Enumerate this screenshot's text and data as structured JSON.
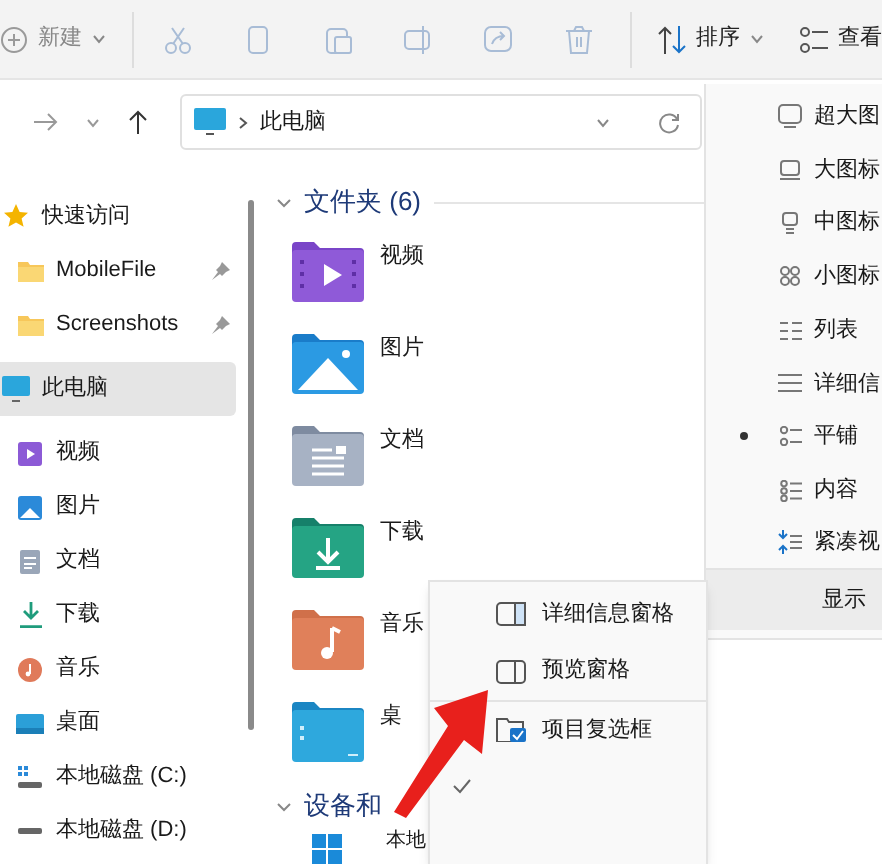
{
  "toolbar": {
    "items": [
      {
        "kind": "new",
        "label": "新建"
      },
      {
        "kind": "cut"
      },
      {
        "kind": "copy"
      },
      {
        "kind": "paste"
      },
      {
        "kind": "rename"
      },
      {
        "kind": "share"
      },
      {
        "kind": "delete"
      },
      {
        "kind": "sort",
        "label": "排序"
      },
      {
        "kind": "view",
        "label": "查看"
      }
    ]
  },
  "address": {
    "path": "此电脑"
  },
  "nav": {
    "items": [
      {
        "label": "快速访问",
        "kind": "star",
        "selected": false,
        "pinned": false
      },
      {
        "label": "MobileFile",
        "kind": "folder",
        "selected": false,
        "pinned": true
      },
      {
        "label": "Screenshots",
        "kind": "folder",
        "selected": false,
        "pinned": true
      },
      {
        "label": "此电脑",
        "kind": "pc",
        "selected": true,
        "pinned": false
      },
      {
        "label": "视频",
        "kind": "video",
        "selected": false,
        "pinned": false
      },
      {
        "label": "图片",
        "kind": "picture",
        "selected": false,
        "pinned": false
      },
      {
        "label": "文档",
        "kind": "document",
        "selected": false,
        "pinned": false
      },
      {
        "label": "下载",
        "kind": "download",
        "selected": false,
        "pinned": false
      },
      {
        "label": "音乐",
        "kind": "music",
        "selected": false,
        "pinned": false
      },
      {
        "label": "桌面",
        "kind": "desktop",
        "selected": false,
        "pinned": false
      },
      {
        "label": "本地磁盘 (C:)",
        "kind": "systemdrive",
        "selected": false,
        "pinned": false
      },
      {
        "label": "本地磁盘 (D:)",
        "kind": "drive",
        "selected": false,
        "pinned": false
      }
    ]
  },
  "sections": [
    {
      "title": "文件夹 (6)",
      "expanded": true,
      "items": [
        {
          "label": "视频",
          "kind": "video"
        },
        {
          "label": "图片",
          "kind": "picture"
        },
        {
          "label": "文档",
          "kind": "document"
        },
        {
          "label": "下载",
          "kind": "download"
        },
        {
          "label": "音乐",
          "kind": "music"
        },
        {
          "label": "桌",
          "kind": "desktop"
        }
      ]
    },
    {
      "title": "设备和",
      "expanded": true,
      "items": [
        {
          "label": "本地",
          "kind": "windrive"
        }
      ]
    }
  ],
  "view_menu": {
    "items": [
      {
        "label": "超大图",
        "kind": "xl",
        "selected": false
      },
      {
        "label": "大图标",
        "kind": "large",
        "selected": false
      },
      {
        "label": "中图标",
        "kind": "medium",
        "selected": false
      },
      {
        "label": "小图标",
        "kind": "small",
        "selected": false
      },
      {
        "label": "列表",
        "kind": "list",
        "selected": false
      },
      {
        "label": "详细信",
        "kind": "details",
        "selected": false
      },
      {
        "label": "平铺",
        "kind": "tiles",
        "selected": true
      },
      {
        "label": "内容",
        "kind": "content",
        "selected": false
      },
      {
        "label": "紧凑视",
        "kind": "compact",
        "selected": false
      }
    ],
    "show": {
      "label": "显示",
      "highlighted": true
    }
  },
  "show_submenu": {
    "items": [
      {
        "label": "详细信息窗格",
        "kind": "details_pane"
      },
      {
        "label": "预览窗格",
        "kind": "preview_pane"
      },
      {
        "label": "项目复选框",
        "kind": "checkbox_option",
        "checked": false
      },
      {
        "kind": "option",
        "checked": true
      }
    ]
  },
  "annotation": {
    "kind": "arrow"
  }
}
